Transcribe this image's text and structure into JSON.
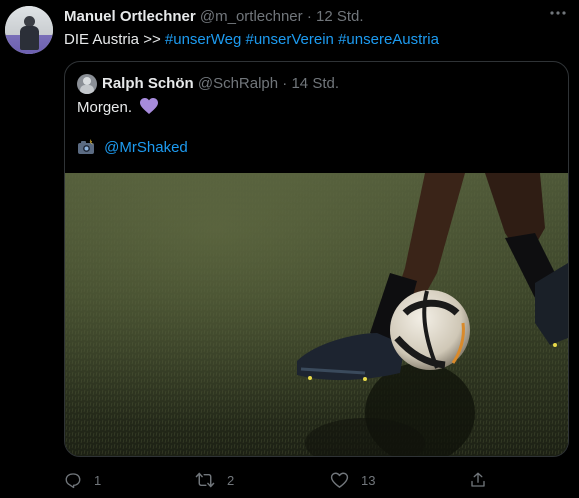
{
  "tweet": {
    "author_name": "Manuel Ortlechner",
    "author_handle": "@m_ortlechner",
    "separator": "·",
    "time": "12 Std.",
    "more_icon": "more-dots-icon",
    "text_prefix": "DIE Austria >>",
    "hashtags": [
      "#unserWeg",
      "#unserVerein",
      "#unsereAustria"
    ]
  },
  "quote": {
    "author_name": "Ralph Schön",
    "author_handle": "@SchRalph",
    "separator": "·",
    "time": "14 Std.",
    "line1": "Morgen.",
    "line1_emoji": "purple-heart-icon",
    "line2_emoji": "camera-flash-icon",
    "line2": "@MrShaked",
    "media": "photo of football boots kicking a ball on artificial turf at night"
  },
  "actions": {
    "reply_count": "1",
    "retweet_count": "2",
    "like_count": "13"
  },
  "colors": {
    "background": "#000000",
    "text": "#e7e9ea",
    "muted": "#71767b",
    "link": "#1d9bf0",
    "border": "#2f3336",
    "heart": "#a78bdc"
  }
}
